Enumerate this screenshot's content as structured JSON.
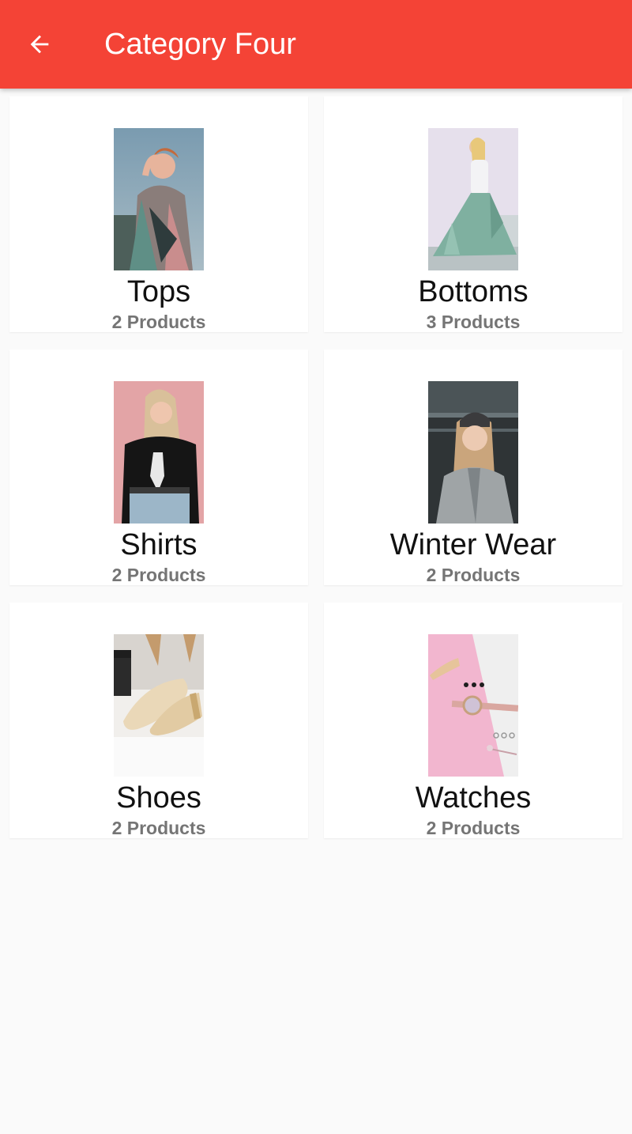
{
  "appbar": {
    "title": "Category Four",
    "back_icon": "arrow-left-icon",
    "color": "#f44336"
  },
  "categories": [
    {
      "name": "Tops",
      "count": "2 Products"
    },
    {
      "name": "Bottoms",
      "count": "3 Products"
    },
    {
      "name": "Shirts",
      "count": "2 Products"
    },
    {
      "name": "Winter Wear",
      "count": "2 Products"
    },
    {
      "name": "Shoes",
      "count": "2 Products"
    },
    {
      "name": "Watches",
      "count": "2 Products"
    }
  ]
}
